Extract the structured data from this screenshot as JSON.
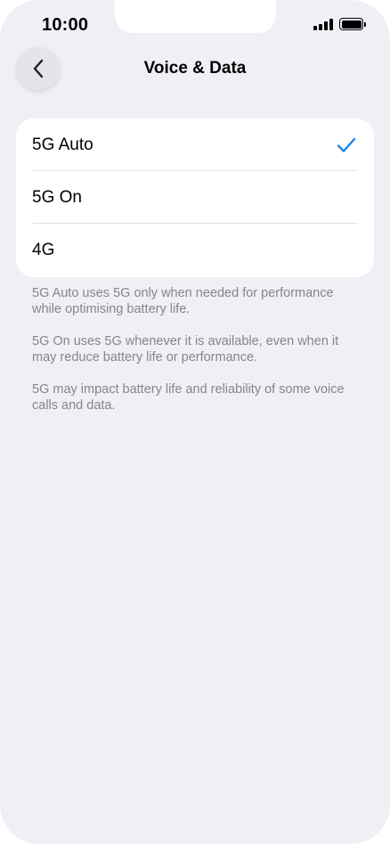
{
  "status_bar": {
    "time": "10:00",
    "signal_icon": "cellular-signal-icon",
    "battery_icon": "battery-full-icon"
  },
  "nav": {
    "back_icon": "chevron-left-icon",
    "title": "Voice & Data"
  },
  "options": [
    {
      "label": "5G Auto",
      "selected": true
    },
    {
      "label": "5G On",
      "selected": false
    },
    {
      "label": "4G",
      "selected": false
    }
  ],
  "footnotes": [
    "5G Auto uses 5G only when needed for performance while optimising battery life.",
    "5G On uses 5G whenever it is available, even when it may reduce battery life or performance.",
    "5G may impact battery life and reliability of some voice calls and data."
  ],
  "colors": {
    "accent": "#1a86e6",
    "background": "#f0eff5",
    "secondary_text": "#86858b"
  }
}
